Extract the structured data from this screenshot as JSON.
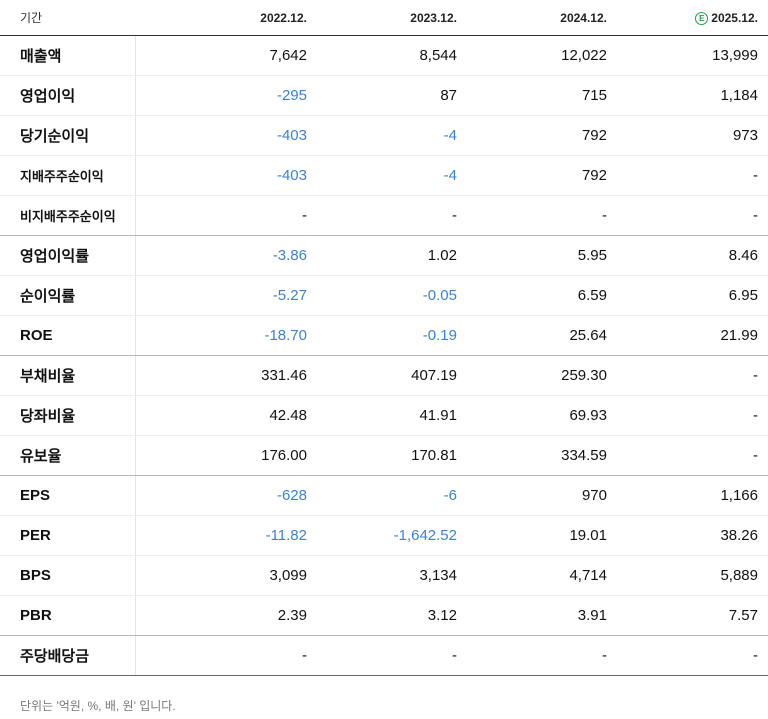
{
  "header": {
    "period_label": "기간",
    "columns": [
      "2022.12.",
      "2023.12.",
      "2024.12.",
      "2025.12."
    ],
    "estimate_icon": "E"
  },
  "rows": [
    {
      "label": "매출액",
      "values": [
        "7,642",
        "8,544",
        "12,022",
        "13,999"
      ],
      "neg": [
        false,
        false,
        false,
        false
      ]
    },
    {
      "label": "영업이익",
      "values": [
        "-295",
        "87",
        "715",
        "1,184"
      ],
      "neg": [
        true,
        false,
        false,
        false
      ]
    },
    {
      "label": "당기순이익",
      "values": [
        "-403",
        "-4",
        "792",
        "973"
      ],
      "neg": [
        true,
        true,
        false,
        false
      ]
    },
    {
      "label": "지배주주순이익",
      "values": [
        "-403",
        "-4",
        "792",
        "-"
      ],
      "neg": [
        true,
        true,
        false,
        false
      ]
    },
    {
      "label": "비지배주주순이익",
      "values": [
        "-",
        "-",
        "-",
        "-"
      ],
      "neg": [
        false,
        false,
        false,
        false
      ]
    },
    {
      "label": "영업이익률",
      "values": [
        "-3.86",
        "1.02",
        "5.95",
        "8.46"
      ],
      "neg": [
        true,
        false,
        false,
        false
      ]
    },
    {
      "label": "순이익률",
      "values": [
        "-5.27",
        "-0.05",
        "6.59",
        "6.95"
      ],
      "neg": [
        true,
        true,
        false,
        false
      ]
    },
    {
      "label": "ROE",
      "values": [
        "-18.70",
        "-0.19",
        "25.64",
        "21.99"
      ],
      "neg": [
        true,
        true,
        false,
        false
      ]
    },
    {
      "label": "부채비율",
      "values": [
        "331.46",
        "407.19",
        "259.30",
        "-"
      ],
      "neg": [
        false,
        false,
        false,
        false
      ]
    },
    {
      "label": "당좌비율",
      "values": [
        "42.48",
        "41.91",
        "69.93",
        "-"
      ],
      "neg": [
        false,
        false,
        false,
        false
      ]
    },
    {
      "label": "유보율",
      "values": [
        "176.00",
        "170.81",
        "334.59",
        "-"
      ],
      "neg": [
        false,
        false,
        false,
        false
      ]
    },
    {
      "label": "EPS",
      "values": [
        "-628",
        "-6",
        "970",
        "1,166"
      ],
      "neg": [
        true,
        true,
        false,
        false
      ]
    },
    {
      "label": "PER",
      "values": [
        "-11.82",
        "-1,642.52",
        "19.01",
        "38.26"
      ],
      "neg": [
        true,
        true,
        false,
        false
      ]
    },
    {
      "label": "BPS",
      "values": [
        "3,099",
        "3,134",
        "4,714",
        "5,889"
      ],
      "neg": [
        false,
        false,
        false,
        false
      ]
    },
    {
      "label": "PBR",
      "values": [
        "2.39",
        "3.12",
        "3.91",
        "7.57"
      ],
      "neg": [
        false,
        false,
        false,
        false
      ]
    },
    {
      "label": "주당배당금",
      "values": [
        "-",
        "-",
        "-",
        "-"
      ],
      "neg": [
        false,
        false,
        false,
        false
      ]
    }
  ],
  "footnote": "단위는 '억원, %, 배, 원' 입니다.",
  "colors": {
    "negative": "#3b82d6",
    "estimate": "#1aa34a"
  }
}
